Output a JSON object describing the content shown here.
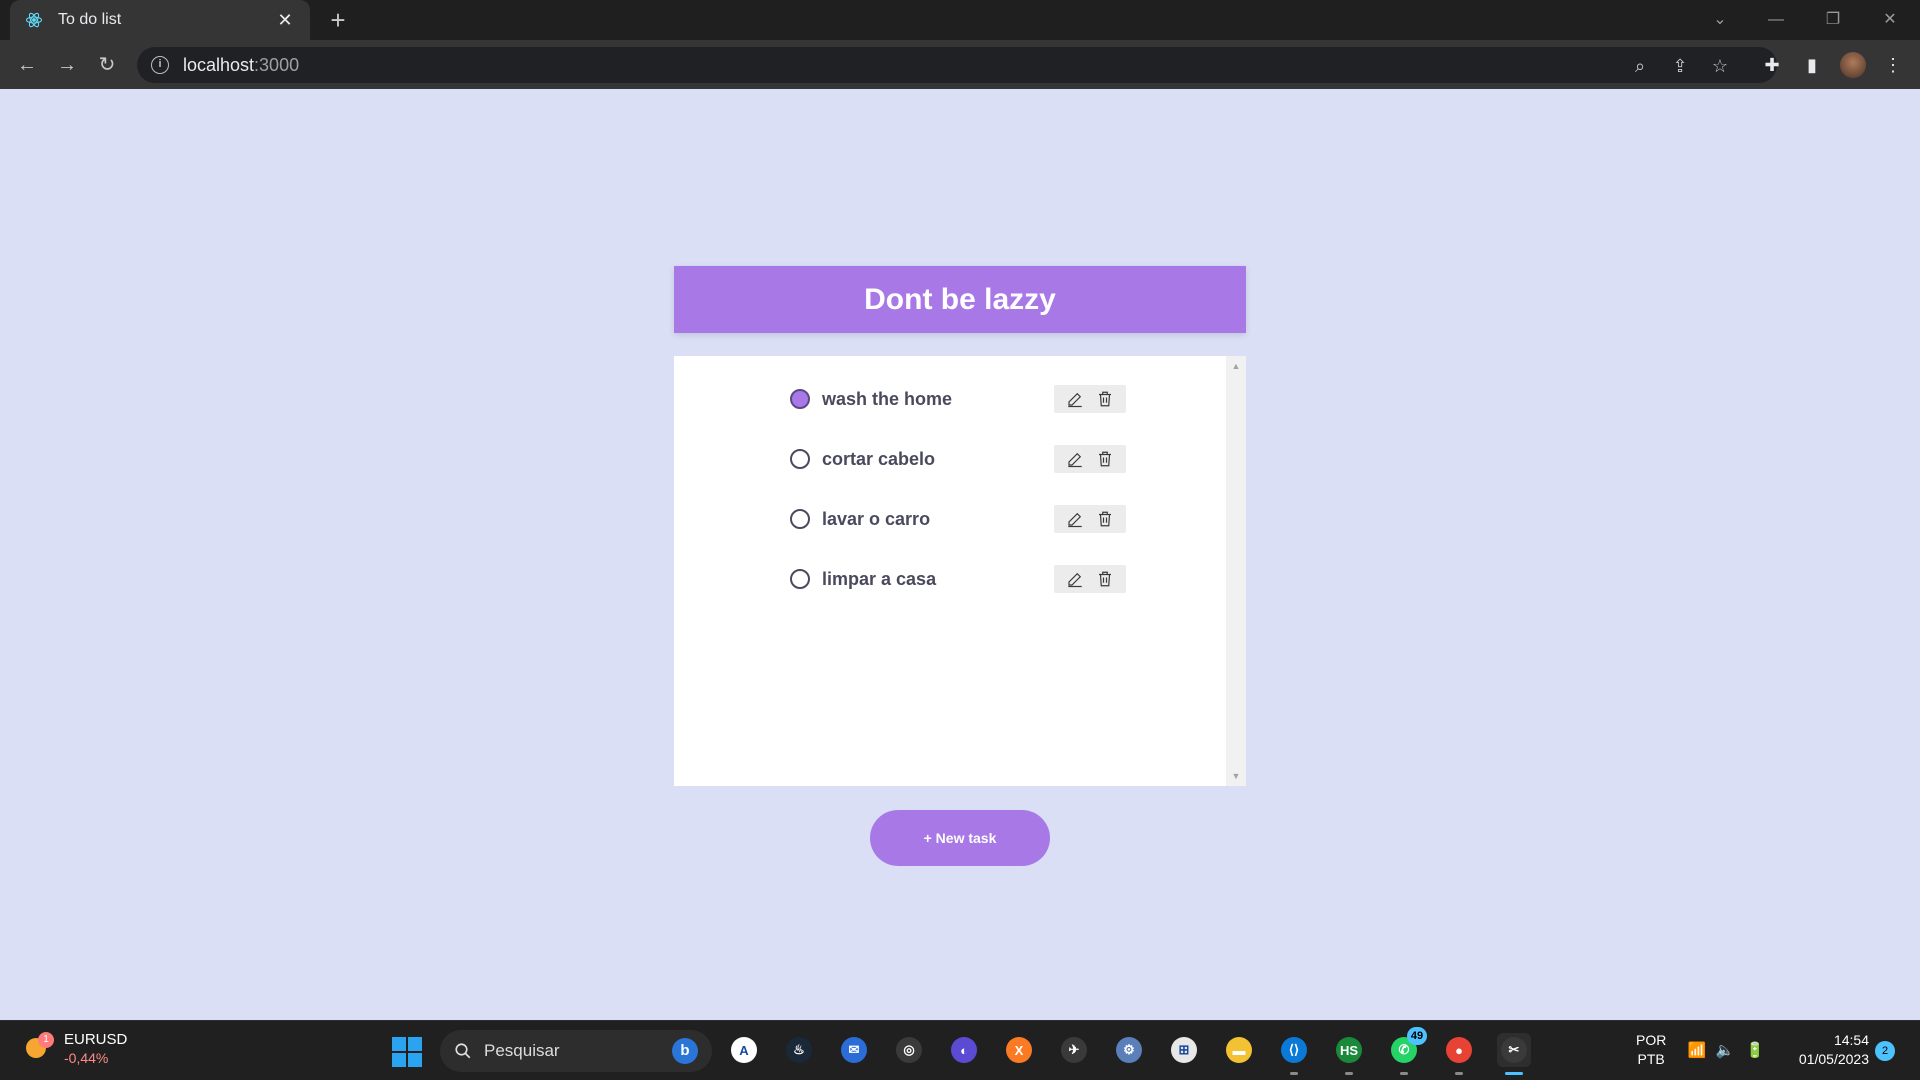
{
  "browser": {
    "tab_title": "To do list",
    "url_host": "localhost",
    "url_port": ":3000"
  },
  "app": {
    "title": "Dont be lazzy",
    "tasks": [
      {
        "text": "wash the home",
        "done": true
      },
      {
        "text": "cortar cabelo",
        "done": false
      },
      {
        "text": "lavar o carro",
        "done": false
      },
      {
        "text": "limpar a casa",
        "done": false
      }
    ],
    "new_task_label": "+ New task",
    "accent_color": "#a879e6",
    "background_color": "#dadff5"
  },
  "taskbar": {
    "widget": {
      "title": "EURUSD",
      "value": "-0,44%",
      "badge": "1"
    },
    "search_placeholder": "Pesquisar",
    "search_bing_label": "b",
    "apps": [
      {
        "name": "app-blue-a",
        "label": "A"
      },
      {
        "name": "steam",
        "label": "♨"
      },
      {
        "name": "mail",
        "label": "✉"
      },
      {
        "name": "obs",
        "label": "◎"
      },
      {
        "name": "vpn",
        "label": "◐"
      },
      {
        "name": "xampp",
        "label": "X"
      },
      {
        "name": "game",
        "label": "✈"
      },
      {
        "name": "settings",
        "label": "⚙"
      },
      {
        "name": "windows-app",
        "label": "⊞"
      },
      {
        "name": "file-explorer",
        "label": "▬"
      },
      {
        "name": "vscode",
        "label": "⟨⟩"
      },
      {
        "name": "hs",
        "label": "HS"
      },
      {
        "name": "whatsapp",
        "label": "✆",
        "badge": "49"
      },
      {
        "name": "chrome",
        "label": "●"
      },
      {
        "name": "snipping-tool",
        "label": "✂"
      }
    ],
    "language_top": "POR",
    "language_bottom": "PTB",
    "time": "14:54",
    "date": "01/05/2023",
    "notifications": "2"
  }
}
